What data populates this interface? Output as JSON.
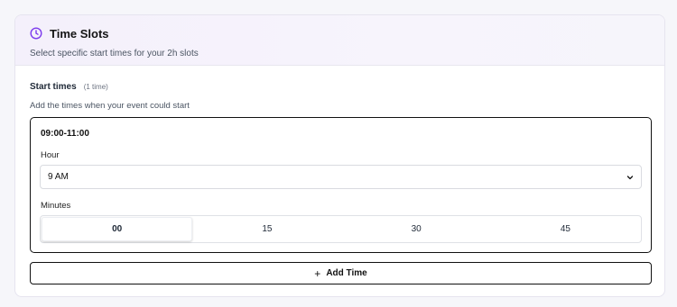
{
  "card": {
    "title": "Time Slots",
    "subtitle": "Select specific start times for your 2h slots",
    "icon": "clock-icon",
    "accent_color": "#7c3aed"
  },
  "start_times": {
    "label": "Start times",
    "count": "(1 time)",
    "help": "Add the times when your event could start"
  },
  "slot": {
    "range": "09:00-11:00",
    "hour_label": "Hour",
    "hour_value": "9 AM",
    "minutes_label": "Minutes",
    "minutes": [
      "00",
      "15",
      "30",
      "45"
    ],
    "selected_minute": "00"
  },
  "add_button": {
    "label": "Add Time",
    "icon": "plus-icon"
  }
}
